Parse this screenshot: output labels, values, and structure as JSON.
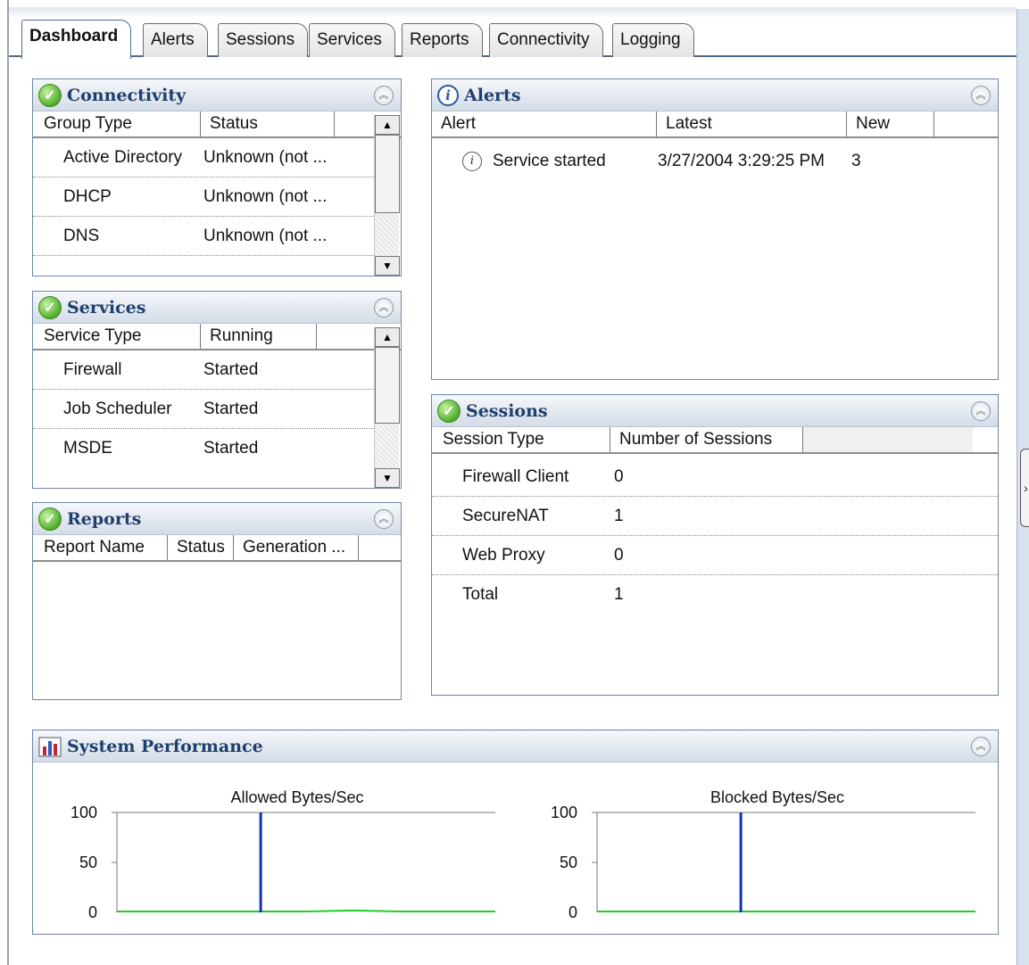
{
  "tabs": [
    {
      "label": "Dashboard",
      "active": true
    },
    {
      "label": "Alerts"
    },
    {
      "label": "Sessions"
    },
    {
      "label": "Services"
    },
    {
      "label": "Reports"
    },
    {
      "label": "Connectivity"
    },
    {
      "label": "Logging"
    }
  ],
  "connectivity": {
    "title": "Connectivity",
    "columns": [
      "Group Type",
      "Status"
    ],
    "rows": [
      {
        "group": "Active Directory",
        "status": "Unknown (not ..."
      },
      {
        "group": "DHCP",
        "status": "Unknown (not ..."
      },
      {
        "group": "DNS",
        "status": "Unknown (not ..."
      }
    ]
  },
  "services": {
    "title": "Services",
    "columns": [
      "Service Type",
      "Running"
    ],
    "rows": [
      {
        "type": "Firewall",
        "running": "Started"
      },
      {
        "type": "Job Scheduler",
        "running": "Started"
      },
      {
        "type": "MSDE",
        "running": "Started"
      }
    ]
  },
  "reports": {
    "title": "Reports",
    "columns": [
      "Report Name",
      "Status",
      "Generation ..."
    ]
  },
  "alerts": {
    "title": "Alerts",
    "columns": [
      "Alert",
      "Latest",
      "New"
    ],
    "rows": [
      {
        "alert": "Service started",
        "latest": "3/27/2004 3:29:25 PM",
        "new": "3"
      }
    ]
  },
  "sessions": {
    "title": "Sessions",
    "columns": [
      "Session Type",
      "Number of Sessions"
    ],
    "rows": [
      {
        "type": "Firewall Client",
        "count": "0"
      },
      {
        "type": "SecureNAT",
        "count": "1"
      },
      {
        "type": "Web Proxy",
        "count": "0"
      },
      {
        "type": "Total",
        "count": "1"
      }
    ]
  },
  "system_performance": {
    "title": "System Performance"
  },
  "chart_data": [
    {
      "type": "line",
      "title": "Allowed Bytes/Sec",
      "yticks": [
        "100",
        "50",
        "0"
      ],
      "ylim": [
        0,
        100
      ],
      "series": [
        {
          "color": "#22cc22",
          "values": [
            0,
            0,
            0,
            0,
            0,
            1,
            0,
            0,
            0
          ]
        },
        {
          "color": "#1a2fb0",
          "marker_x": 0.38
        }
      ],
      "colors": {
        "cursor": "#1a2fb0",
        "line": "#22cc22"
      }
    },
    {
      "type": "line",
      "title": "Blocked Bytes/Sec",
      "yticks": [
        "100",
        "50",
        "0"
      ],
      "ylim": [
        0,
        100
      ],
      "series": [
        {
          "color": "#22cc22",
          "values": [
            0,
            0,
            0,
            0,
            0,
            0,
            0,
            0,
            0
          ]
        },
        {
          "color": "#1a2fb0",
          "marker_x": 0.38
        }
      ],
      "colors": {
        "cursor": "#1a2fb0",
        "line": "#22cc22"
      }
    }
  ]
}
